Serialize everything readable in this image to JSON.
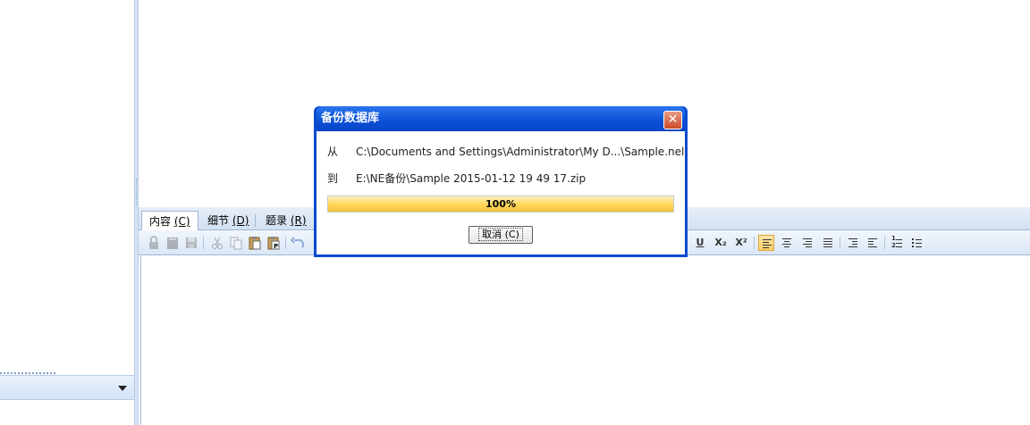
{
  "dialog": {
    "title": "备份数据库",
    "close_glyph": "✕",
    "from_label": "从",
    "from_path": "C:\\Documents and Settings\\Administrator\\My D...\\Sample.nel",
    "to_label": "到",
    "to_path": "E:\\NE备份\\Sample 2015-01-12 19 49 17.zip",
    "progress": 1.0,
    "progress_text": "100%",
    "cancel_label": "取消 (C)"
  },
  "tabs": [
    {
      "name": "内容",
      "acc": "(C)"
    },
    {
      "name": "细节",
      "acc": "(D)"
    },
    {
      "name": "题录",
      "acc": "(R)"
    }
  ],
  "toolbar": {
    "underline": "U",
    "subscript": "X₂",
    "superscript": "X²",
    "icons": [
      "lock-icon",
      "book-icon",
      "save-icon",
      "cut-icon",
      "copy-icon",
      "paste-icon",
      "paste-special-icon",
      "undo-icon",
      "underline-icon",
      "subscript-icon",
      "superscript-icon",
      "align-left-icon",
      "align-center-icon",
      "align-right-icon",
      "align-justify-icon",
      "indent-icon",
      "outdent-icon",
      "numbered-list-icon",
      "bullet-list-icon"
    ]
  },
  "colors": {
    "dialog_frame": "#0a4ad0",
    "progress_fill": "#ffd657",
    "close_button": "#cc4a27",
    "ribbon": "#d3e1f2"
  }
}
